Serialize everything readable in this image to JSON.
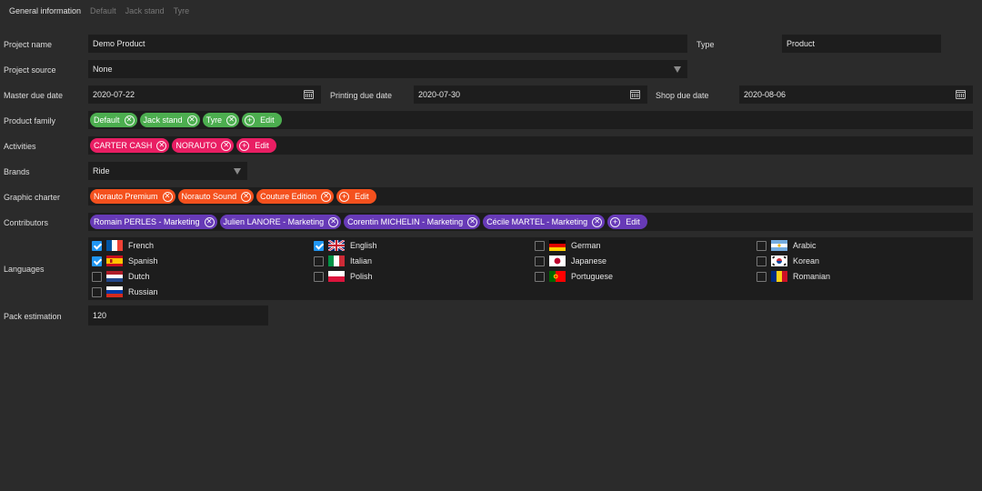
{
  "tabs": [
    "General information",
    "Default",
    "Jack stand",
    "Tyre"
  ],
  "form": {
    "project_name": {
      "label": "Project name",
      "value": "Demo Product"
    },
    "type": {
      "label": "Type",
      "value": "Product"
    },
    "project_source": {
      "label": "Project source",
      "value": "None"
    },
    "master_due_date": {
      "label": "Master due date",
      "value": "2020-07-22"
    },
    "printing_due_date": {
      "label": "Printing due date",
      "value": "2020-07-30"
    },
    "shop_due_date": {
      "label": "Shop due date",
      "value": "2020-08-06"
    },
    "product_family": {
      "label": "Product family",
      "chips": [
        "Default",
        "Jack stand",
        "Tyre"
      ],
      "edit": "Edit"
    },
    "activities": {
      "label": "Activities",
      "chips": [
        "CARTER CASH",
        "NORAUTO"
      ],
      "edit": "Edit"
    },
    "brands": {
      "label": "Brands",
      "value": "Ride"
    },
    "graphic_charter": {
      "label": "Graphic charter",
      "chips": [
        "Norauto Premium",
        "Norauto Sound",
        "Couture Edition"
      ],
      "edit": "Edit"
    },
    "contributors": {
      "label": "Contributors",
      "chips": [
        "Romain PERLES - Marketing",
        "Julien LANORE - Marketing",
        "Corentin MICHELIN - Marketing",
        "Cécile MARTEL - Marketing"
      ],
      "edit": "Edit"
    },
    "languages": {
      "label": "Languages",
      "items": [
        {
          "name": "French",
          "checked": true,
          "flag": "fr"
        },
        {
          "name": "English",
          "checked": true,
          "flag": "gb"
        },
        {
          "name": "German",
          "checked": false,
          "flag": "de"
        },
        {
          "name": "Arabic",
          "checked": false,
          "flag": "ar"
        },
        {
          "name": "Spanish",
          "checked": true,
          "flag": "es"
        },
        {
          "name": "Italian",
          "checked": false,
          "flag": "it"
        },
        {
          "name": "Japanese",
          "checked": false,
          "flag": "jp"
        },
        {
          "name": "Korean",
          "checked": false,
          "flag": "kr"
        },
        {
          "name": "Dutch",
          "checked": false,
          "flag": "nl"
        },
        {
          "name": "Polish",
          "checked": false,
          "flag": "pl"
        },
        {
          "name": "Portuguese",
          "checked": false,
          "flag": "pt"
        },
        {
          "name": "Romanian",
          "checked": false,
          "flag": "ro"
        },
        {
          "name": "Russian",
          "checked": false,
          "flag": "ru"
        }
      ]
    },
    "pack_estimation": {
      "label": "Pack estimation",
      "value": "120"
    }
  },
  "colors": {
    "background": "#2b2b2b",
    "field": "#1d1d1d",
    "product_family_chip": "#4cae4f",
    "activities_chip": "#e91e63",
    "graphic_charter_chip": "#f4511e",
    "contributors_chip": "#673ab7",
    "checkbox_checked": "#2196f3"
  }
}
